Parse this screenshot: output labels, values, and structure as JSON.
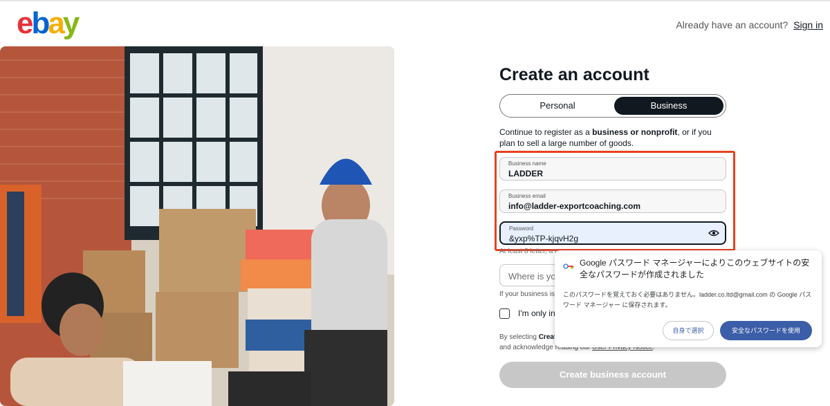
{
  "header": {
    "logo": {
      "e": "e",
      "b": "b",
      "a": "a",
      "y": "y"
    },
    "already_text": "Already have an account?",
    "signin_label": "Sign in"
  },
  "form": {
    "title": "Create an account",
    "tabs": [
      {
        "label": "Personal",
        "selected": false
      },
      {
        "label": "Business",
        "selected": true
      }
    ],
    "desc_prefix": "Continue to register as a ",
    "desc_bold": "business or nonprofit",
    "desc_suffix": ", or if you plan to sell a large number of goods.",
    "fields": {
      "business_name": {
        "label": "Business name",
        "value": "LADDER"
      },
      "business_email": {
        "label": "Business email",
        "value": "info@ladder-exportcoaching.com"
      },
      "password": {
        "label": "Password",
        "value": "&yxp%TP-kjqvH2g"
      }
    },
    "password_hint": "At least 8 letter, a n",
    "where_placeholder": "Where is your",
    "if_your": "If your business isn",
    "checkbox_label": "I'm only int",
    "legal_prefix": "By selecting ",
    "legal_bold": "Create",
    "legal_line2_prefix": "and acknowledge reading our ",
    "legal_link": "User Privacy Notice",
    "legal_line2_suffix": ".",
    "submit_label": "Create business account"
  },
  "google_popup": {
    "title": "Google パスワード マネージャーによりこのウェブサイトの安全なパスワードが作成されました",
    "body": "このパスワードを覚えておく必要はありません。ladder.co.ltd@gmail.com の Google パスワード マネージャー に保存されます。",
    "btn_self": "自身で選択",
    "btn_use": "安全なパスワードを使用"
  },
  "colors": {
    "highlight_border": "#e8411e",
    "google_blue": "#3c5ea8",
    "disabled_button": "#c7c7c7"
  }
}
